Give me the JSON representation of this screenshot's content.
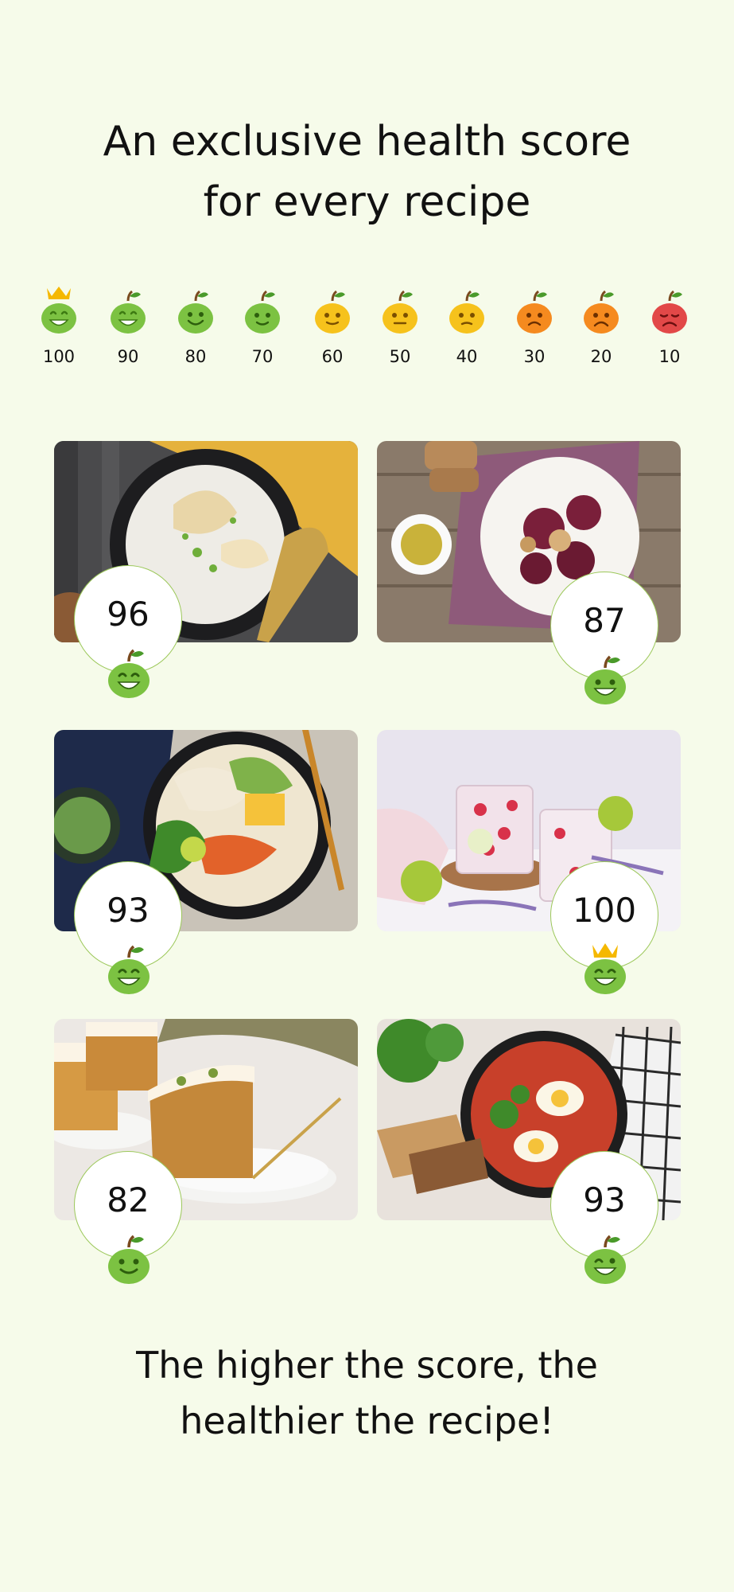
{
  "headline": {
    "line1": "An exclusive health score",
    "line2": "for every recipe"
  },
  "scale": [
    {
      "value": "100",
      "mood": "crowned-green-apple-icon",
      "color": "#7cc242"
    },
    {
      "value": "90",
      "mood": "green-apple-icon",
      "color": "#7cc242"
    },
    {
      "value": "80",
      "mood": "green-apple-icon",
      "color": "#7cc242"
    },
    {
      "value": "70",
      "mood": "green-apple-icon",
      "color": "#7cc242"
    },
    {
      "value": "60",
      "mood": "yellow-apple-icon",
      "color": "#f6c21c"
    },
    {
      "value": "50",
      "mood": "yellow-apple-icon",
      "color": "#f6c21c"
    },
    {
      "value": "40",
      "mood": "yellow-apple-icon",
      "color": "#f6c21c"
    },
    {
      "value": "30",
      "mood": "orange-apple-icon",
      "color": "#f58a1f"
    },
    {
      "value": "20",
      "mood": "orange-apple-icon",
      "color": "#f58a1f"
    },
    {
      "value": "10",
      "mood": "sad-red-apple-icon",
      "color": "#e24848"
    }
  ],
  "recipes": [
    {
      "score": "96",
      "image": "pear-rice-bowl-image",
      "mascot": "green-apple-icon"
    },
    {
      "score": "87",
      "image": "beetroot-salad-image",
      "mascot": "green-apple-icon"
    },
    {
      "score": "93",
      "image": "noodle-bowl-image",
      "mascot": "green-apple-icon"
    },
    {
      "score": "100",
      "image": "raspberry-water-image",
      "mascot": "crowned-green-apple-icon"
    },
    {
      "score": "82",
      "image": "carrot-cake-image",
      "mascot": "green-apple-icon"
    },
    {
      "score": "93",
      "image": "shakshuka-image",
      "mascot": "green-apple-icon"
    }
  ],
  "footer": {
    "line1": "The higher the score, the",
    "line2": "healthier the recipe!"
  },
  "colors": {
    "background": "#f6fbea",
    "accent_green": "#7cc242",
    "badge_border": "#9cc85a"
  }
}
